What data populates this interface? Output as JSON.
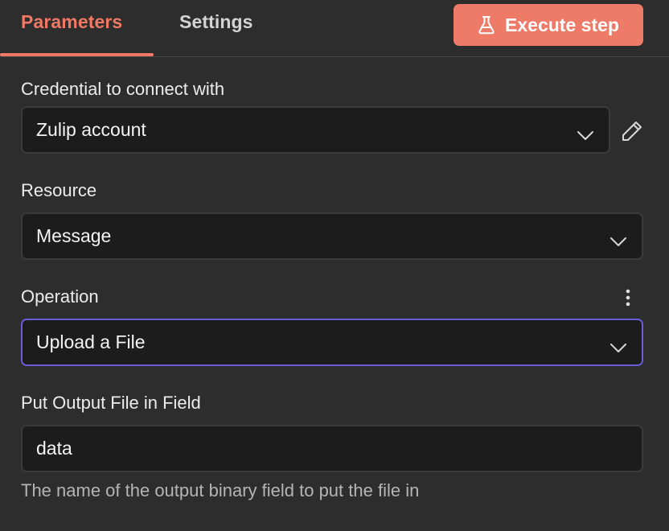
{
  "tabs": {
    "parameters": "Parameters",
    "settings": "Settings"
  },
  "execute_button": {
    "label": "Execute step"
  },
  "fields": {
    "credential": {
      "label": "Credential to connect with",
      "value": "Zulip account"
    },
    "resource": {
      "label": "Resource",
      "value": "Message"
    },
    "operation": {
      "label": "Operation",
      "value": "Upload a File"
    },
    "output_field": {
      "label": "Put Output File in Field",
      "value": "data",
      "hint": "The name of the output binary field to put the file in"
    }
  },
  "colors": {
    "accent": "#f07966",
    "focus_border": "#6b5bd6",
    "background": "#2d2d2d"
  },
  "icons": {
    "execute": "flask-icon",
    "edit": "pencil-icon",
    "options": "kebab-menu-icon",
    "dropdown": "chevron-down-icon"
  }
}
